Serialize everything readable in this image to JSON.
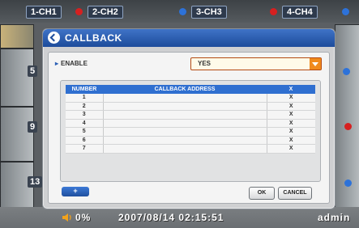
{
  "cameras": {
    "ch1": "1-CH1",
    "ch2": "2-CH2",
    "ch3": "3-CH3",
    "ch4": "4-CH4",
    "ch5": "5",
    "ch9": "9",
    "ch13": "13"
  },
  "status_bar": {
    "volume": "0%",
    "datetime": "2007/08/14  02:15:51",
    "user": "admin"
  },
  "dialog": {
    "title": "CALLBACK",
    "enable_label": "ENABLE",
    "enable_value": "YES",
    "table": {
      "headers": [
        "NUMBER",
        "CALLBACK ADDRESS",
        "X"
      ],
      "rows": [
        {
          "num": "1",
          "addr": "",
          "x": "X"
        },
        {
          "num": "2",
          "addr": "",
          "x": "X"
        },
        {
          "num": "3",
          "addr": "",
          "x": "X"
        },
        {
          "num": "4",
          "addr": "",
          "x": "X"
        },
        {
          "num": "5",
          "addr": "",
          "x": "X"
        },
        {
          "num": "6",
          "addr": "",
          "x": "X"
        },
        {
          "num": "7",
          "addr": "",
          "x": "X"
        }
      ]
    },
    "add_label": "+",
    "ok_label": "OK",
    "cancel_label": "CANCEL"
  },
  "colors": {
    "header_blue": "#1d4c9b",
    "table_header_blue": "#2f6fd0",
    "select_orange": "#f08a1d",
    "alert_red": "#d62020",
    "indicator_blue": "#2d72d9"
  }
}
